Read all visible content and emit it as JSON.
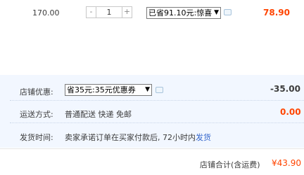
{
  "item": {
    "unit_price": "170.00",
    "quantity": "1",
    "decrement": "-",
    "increment": "+",
    "discount_select": "已省91.10元:惊喜",
    "subtotal": "78.90"
  },
  "shop": {
    "discount_label": "店铺优惠:",
    "coupon_select": "省35元:35元优惠券",
    "discount_amount": "-35.00",
    "shipping_label": "运送方式:",
    "shipping_method": "普通配送 快递 免邮",
    "shipping_fee": "0.00",
    "delivery_label": "发货时间:",
    "delivery_text": "卖家承诺订单在买家付款后, 72小时内",
    "delivery_link": "发货",
    "total_label": "店铺合计(含运费)",
    "total_amount": "¥43.90"
  },
  "colors": {
    "price_red": "#ff4400",
    "panel_bg": "#f2f7ff",
    "link_blue": "#3366cc"
  },
  "icons": [
    "message-icon",
    "dropdown-arrow-icon"
  ]
}
